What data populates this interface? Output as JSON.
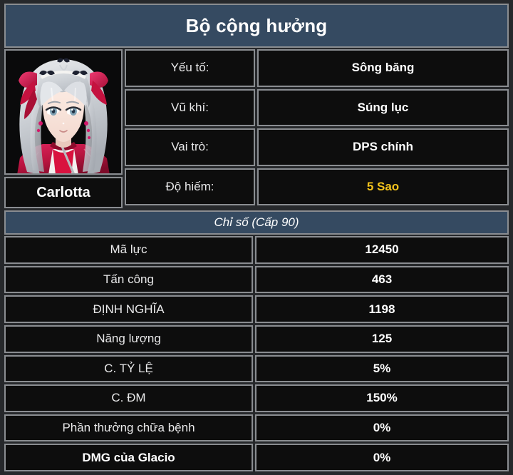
{
  "header": {
    "title": "Bộ cộng hưởng"
  },
  "character": {
    "portrait_icon": "character-portrait-carlotta",
    "name": "Carlotta",
    "info_rows": [
      {
        "label": "Yếu tố:",
        "value": "Sông băng",
        "highlight": false
      },
      {
        "label": "Vũ khí:",
        "value": "Súng lục",
        "highlight": false
      },
      {
        "label": "Vai trò:",
        "value": "DPS chính",
        "highlight": false
      },
      {
        "label": "Độ hiếm:",
        "value": "5 Sao",
        "highlight": true
      }
    ]
  },
  "stats": {
    "section_title": "Chỉ số (Cấp 90)",
    "rows": [
      {
        "label": "Mã lực",
        "value": "12450",
        "bold_label": false
      },
      {
        "label": "Tấn công",
        "value": "463",
        "bold_label": false
      },
      {
        "label": "ĐỊNH NGHĨA",
        "value": "1198",
        "bold_label": false
      },
      {
        "label": "Năng lượng",
        "value": "125",
        "bold_label": false
      },
      {
        "label": "C. TỶ LỆ",
        "value": "5%",
        "bold_label": false
      },
      {
        "label": "C. ĐM",
        "value": "150%",
        "bold_label": false
      },
      {
        "label": "Phần thưởng chữa bệnh",
        "value": "0%",
        "bold_label": false
      },
      {
        "label": "DMG của Glacio",
        "value": "0%",
        "bold_label": true
      }
    ]
  },
  "colors": {
    "accent_slate": "#354A61",
    "cell_background": "#0D0D0D",
    "border_gray": "#8A8D91",
    "rarity_gold": "#F2C21C",
    "page_background": "#26282B",
    "text_primary": "#FFFFFF"
  }
}
